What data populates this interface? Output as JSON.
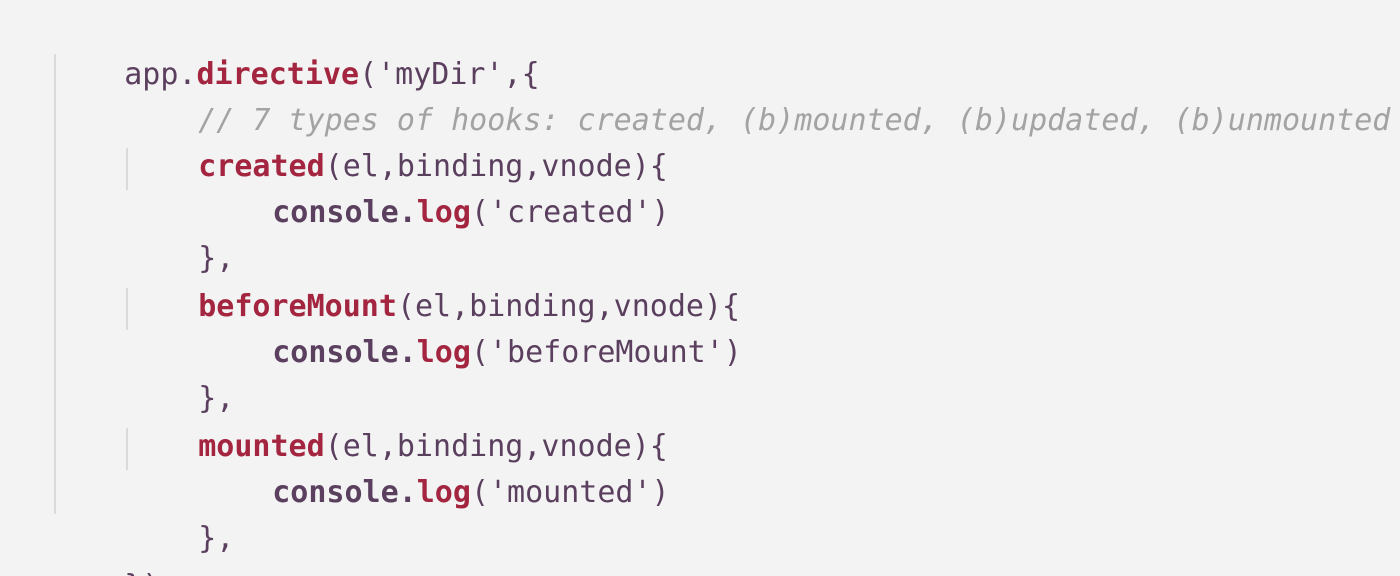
{
  "colors": {
    "background": "#f3f3f3",
    "plain": "#5b3f5e",
    "keyword": "#a3253f",
    "comment": "#a3a3a3",
    "indent_guide": "#dadada"
  },
  "code": {
    "line1": {
      "obj": "app.",
      "method": "directive",
      "args": "('myDir',{"
    },
    "line2": {
      "comment": "// 7 types of hooks: created, (b)mounted, (b)updated, (b)unmounted"
    },
    "line3": {
      "method": "created",
      "params": "(el,binding,vnode){"
    },
    "line4": {
      "obj": "console.",
      "method": "log",
      "args": "('created')"
    },
    "line5": {
      "close": "},"
    },
    "line6": {
      "method": "beforeMount",
      "params": "(el,binding,vnode){"
    },
    "line7": {
      "obj": "console.",
      "method": "log",
      "args": "('beforeMount')"
    },
    "line8": {
      "close": "},"
    },
    "line9": {
      "method": "mounted",
      "params": "(el,binding,vnode){"
    },
    "line10": {
      "obj": "console.",
      "method": "log",
      "args": "('mounted')"
    },
    "line11": {
      "close": "},"
    },
    "line12": {
      "close": "})"
    }
  }
}
